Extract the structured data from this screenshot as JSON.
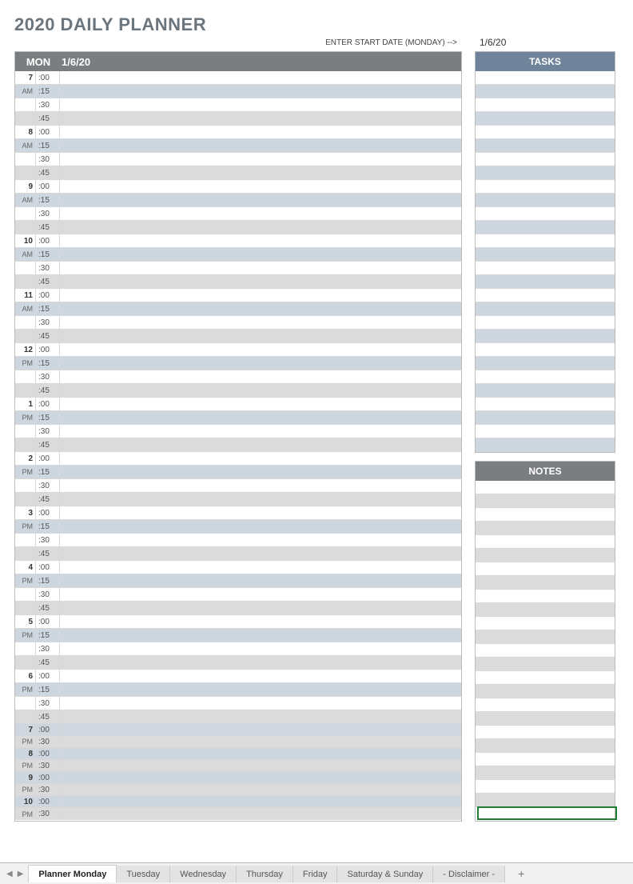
{
  "title": "2020 DAILY PLANNER",
  "start_date_label": "ENTER START DATE (MONDAY)  -->",
  "start_date": "1/6/20",
  "day": {
    "name": "MON",
    "date": "1/6/20"
  },
  "tasks_header": "TASKS",
  "notes_header": "NOTES",
  "slots": [
    {
      "hour": "7",
      "ampm": "AM",
      "minutes": [
        ":00",
        ":15",
        ":30",
        ":45"
      ]
    },
    {
      "hour": "8",
      "ampm": "AM",
      "minutes": [
        ":00",
        ":15",
        ":30",
        ":45"
      ]
    },
    {
      "hour": "9",
      "ampm": "AM",
      "minutes": [
        ":00",
        ":15",
        ":30",
        ":45"
      ]
    },
    {
      "hour": "10",
      "ampm": "AM",
      "minutes": [
        ":00",
        ":15",
        ":30",
        ":45"
      ]
    },
    {
      "hour": "11",
      "ampm": "AM",
      "minutes": [
        ":00",
        ":15",
        ":30",
        ":45"
      ]
    },
    {
      "hour": "12",
      "ampm": "PM",
      "minutes": [
        ":00",
        ":15",
        ":30",
        ":45"
      ]
    },
    {
      "hour": "1",
      "ampm": "PM",
      "minutes": [
        ":00",
        ":15",
        ":30",
        ":45"
      ]
    },
    {
      "hour": "2",
      "ampm": "PM",
      "minutes": [
        ":00",
        ":15",
        ":30",
        ":45"
      ]
    },
    {
      "hour": "3",
      "ampm": "PM",
      "minutes": [
        ":00",
        ":15",
        ":30",
        ":45"
      ]
    },
    {
      "hour": "4",
      "ampm": "PM",
      "minutes": [
        ":00",
        ":15",
        ":30",
        ":45"
      ]
    },
    {
      "hour": "5",
      "ampm": "PM",
      "minutes": [
        ":00",
        ":15",
        ":30",
        ":45"
      ]
    },
    {
      "hour": "6",
      "ampm": "PM",
      "minutes": [
        ":00",
        ":15",
        ":30",
        ":45"
      ]
    },
    {
      "hour": "7",
      "ampm": "PM",
      "minutes": [
        ":00",
        ":30"
      ]
    },
    {
      "hour": "8",
      "ampm": "PM",
      "minutes": [
        ":00",
        ":30"
      ]
    },
    {
      "hour": "9",
      "ampm": "PM",
      "minutes": [
        ":00",
        ":30"
      ]
    },
    {
      "hour": "10",
      "ampm": "PM",
      "minutes": [
        ":00",
        ":30"
      ]
    }
  ],
  "tasks_rows": 28,
  "notes_rows": 25,
  "tabs": [
    {
      "label": "Planner Monday",
      "active": true
    },
    {
      "label": "Tuesday"
    },
    {
      "label": "Wednesday"
    },
    {
      "label": "Thursday"
    },
    {
      "label": "Friday"
    },
    {
      "label": "Saturday & Sunday"
    },
    {
      "label": "- Disclaimer -"
    }
  ],
  "colors": {
    "header_grey": "#7b7e81",
    "header_blue": "#6f839b",
    "row_grey": "#dbdbdb",
    "row_blue": "#ced6e0"
  }
}
